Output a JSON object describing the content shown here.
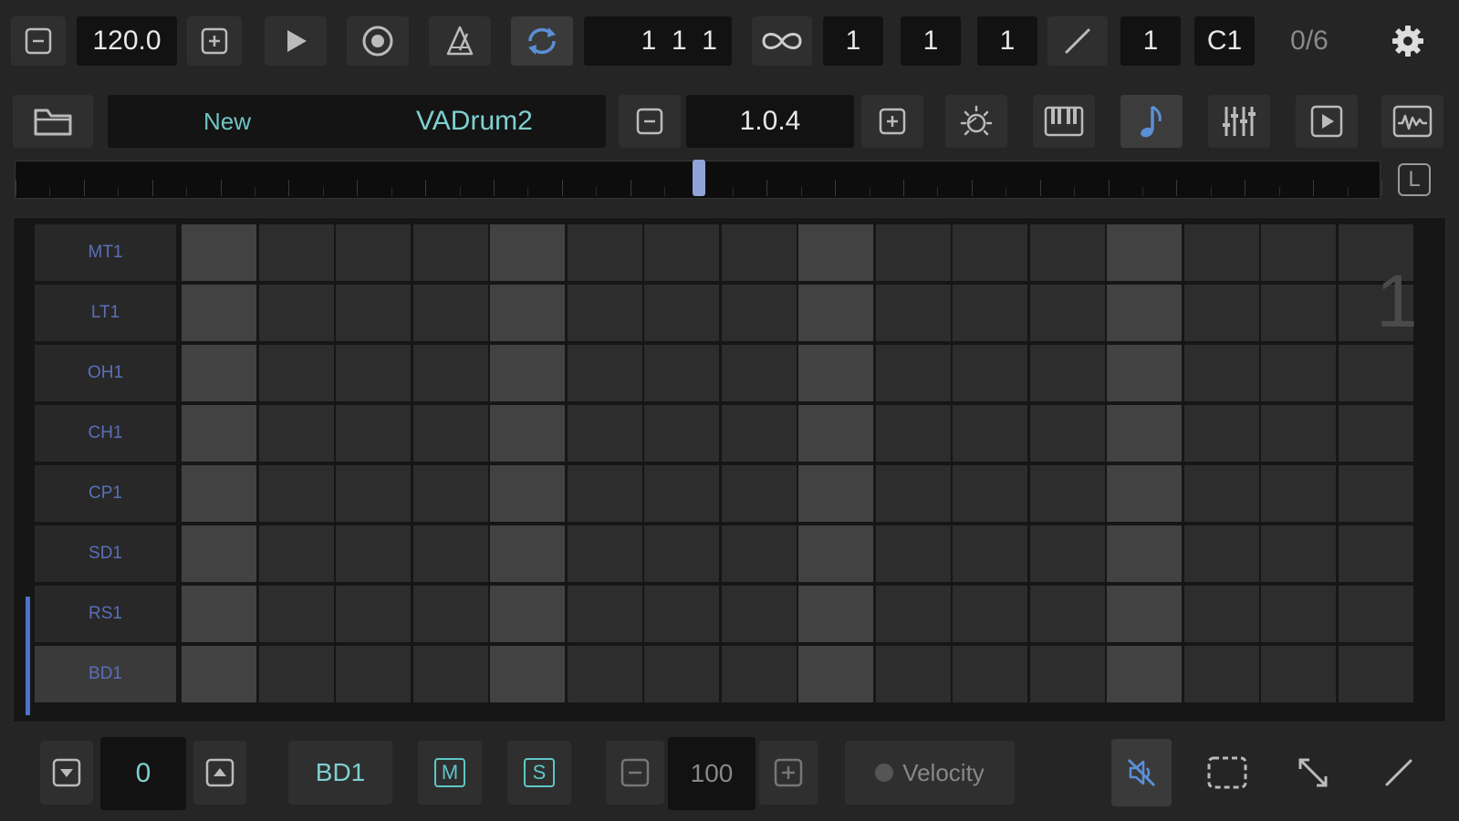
{
  "transport": {
    "tempo": "120.0",
    "position": "1  1  1",
    "loop_a": "1",
    "loop_b": "1",
    "loop_c": "1",
    "loop_d": "1",
    "root_note": "C1",
    "count": "0/6"
  },
  "project": {
    "new_label": "New",
    "name": "VADrum2",
    "version": "1.0.4"
  },
  "track_bar": {
    "lock_label": "L"
  },
  "grid": {
    "page_number": "1",
    "rows": [
      {
        "label": "MT1"
      },
      {
        "label": "LT1"
      },
      {
        "label": "OH1"
      },
      {
        "label": "CH1"
      },
      {
        "label": "CP1"
      },
      {
        "label": "SD1"
      },
      {
        "label": "RS1"
      },
      {
        "label": "BD1"
      }
    ],
    "steps": 16,
    "selected_row": "BD1"
  },
  "bottom": {
    "octave_value": "0",
    "track_name": "BD1",
    "mute_label": "M",
    "solo_label": "S",
    "velocity_value": "100",
    "velocity_label": "Velocity"
  },
  "colors": {
    "accent": "#5b8fd6",
    "label_blue": "#5a6fb8",
    "teal": "#5fc6c6",
    "cell_beat": "#424242",
    "cell_normal": "#2d2d2d"
  }
}
